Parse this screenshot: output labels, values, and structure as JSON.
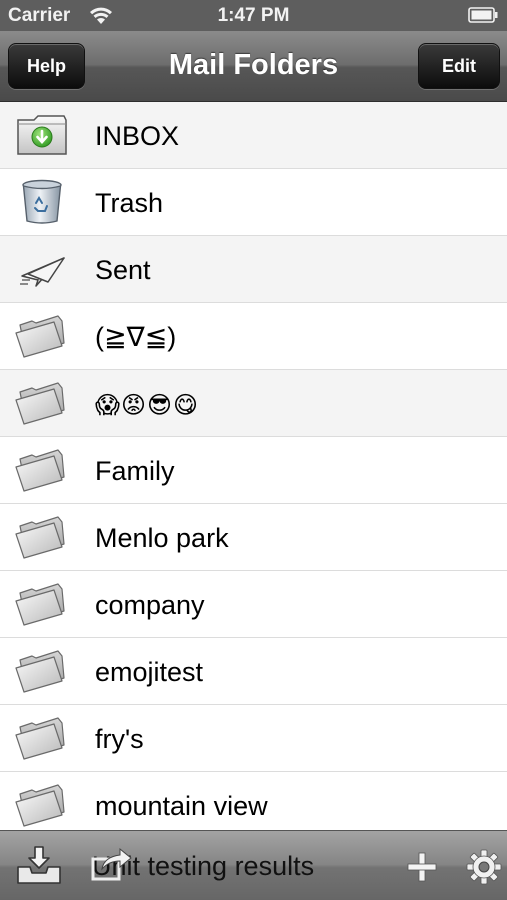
{
  "status_bar": {
    "carrier": "Carrier",
    "time": "1:47 PM"
  },
  "nav": {
    "title": "Mail Folders",
    "help_label": "Help",
    "edit_label": "Edit"
  },
  "folders": [
    {
      "label": "INBOX",
      "icon": "inbox-folder-icon"
    },
    {
      "label": "Trash",
      "icon": "trash-can-icon"
    },
    {
      "label": "Sent",
      "icon": "paper-plane-icon"
    },
    {
      "label": "(≧∇≦)",
      "icon": "folder-icon"
    },
    {
      "label": "😱😡😎😋",
      "icon": "folder-icon"
    },
    {
      "label": "Family",
      "icon": "folder-icon"
    },
    {
      "label": "Menlo park",
      "icon": "folder-icon"
    },
    {
      "label": "company",
      "icon": "folder-icon"
    },
    {
      "label": "emojitest",
      "icon": "folder-icon"
    },
    {
      "label": "fry's",
      "icon": "folder-icon"
    },
    {
      "label": "mountain view",
      "icon": "folder-icon"
    }
  ],
  "toolbar": {
    "status_text": "Unit testing results",
    "icons": [
      "download-tray-icon",
      "compose-forward-icon",
      "add-icon",
      "gear-icon"
    ]
  }
}
